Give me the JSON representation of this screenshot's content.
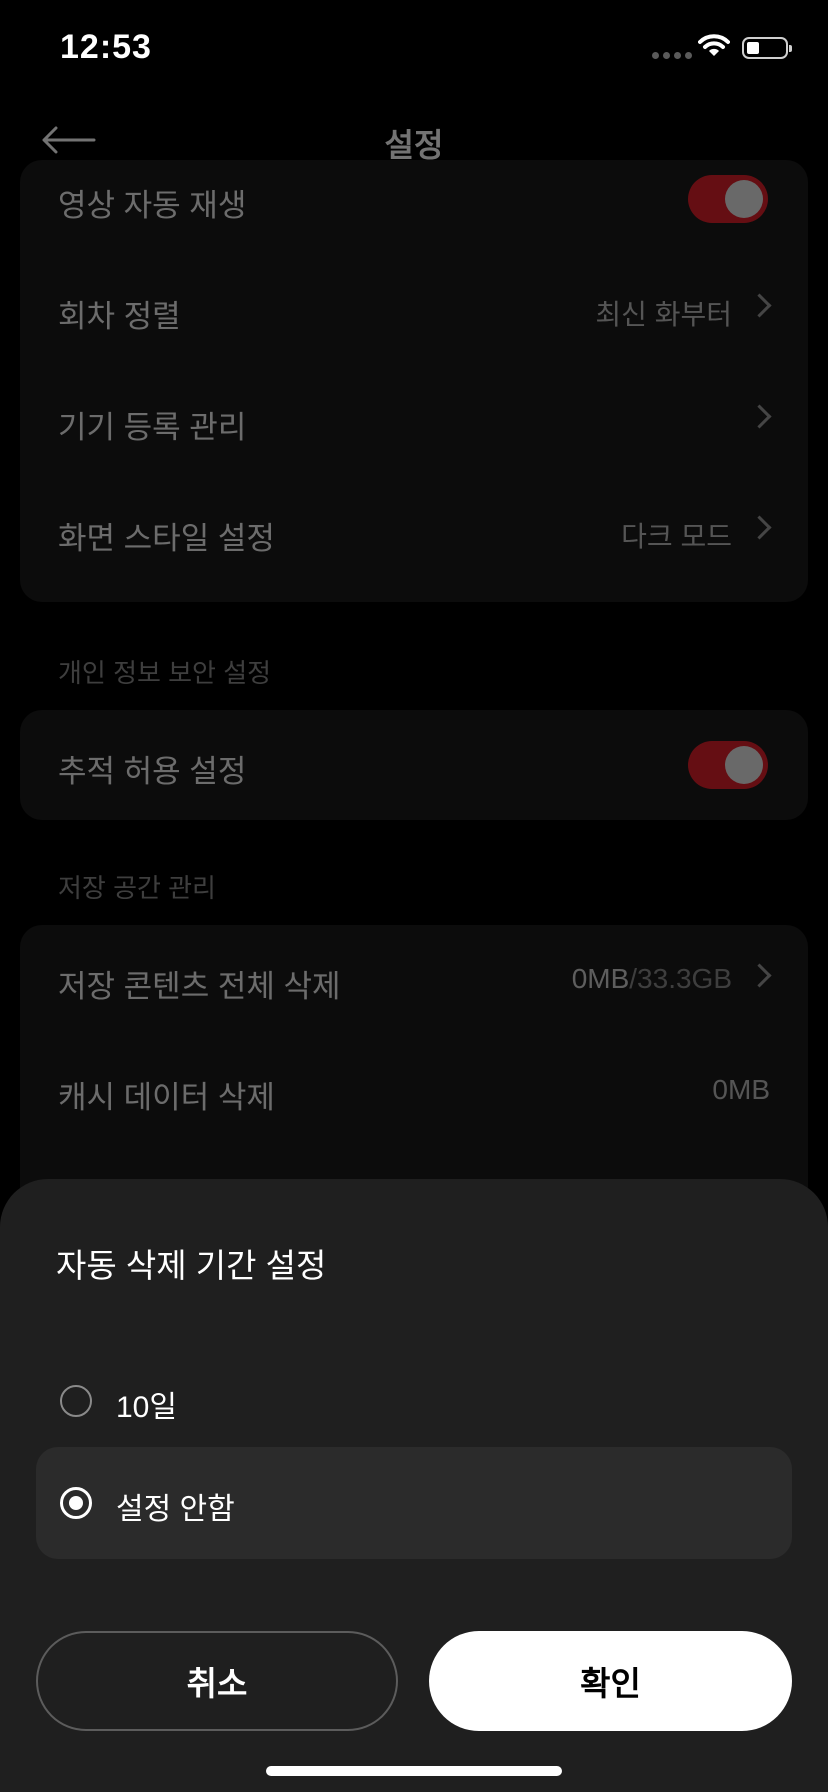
{
  "status_bar": {
    "time": "12:53"
  },
  "header": {
    "title": "설정"
  },
  "settings": {
    "general": [
      {
        "label": "영상 자동 재생",
        "toggle": "on"
      },
      {
        "label": "회차 정렬",
        "value": "최신 화부터"
      },
      {
        "label": "기기 등록 관리",
        "value": ""
      },
      {
        "label": "화면 스타일 설정",
        "value": "다크 모드"
      }
    ],
    "privacy": {
      "header": "개인 정보 보안 설정",
      "items": [
        {
          "label": "추적 허용 설정",
          "toggle": "on"
        }
      ]
    },
    "storage": {
      "header": "저장 공간 관리",
      "items": [
        {
          "label": "저장 콘텐츠 전체 삭제",
          "used": "0MB",
          "total": "/33.3GB"
        },
        {
          "label": "캐시 데이터 삭제",
          "value": "0MB"
        }
      ]
    }
  },
  "sheet": {
    "title": "자동 삭제 기간 설정",
    "options": [
      {
        "label": "10일",
        "selected": false
      },
      {
        "label": "설정 안함",
        "selected": true
      }
    ],
    "cancel_label": "취소",
    "confirm_label": "확인"
  },
  "colors": {
    "accent": "#e0202a",
    "background": "#000000",
    "sheet": "#1f1f1f"
  }
}
